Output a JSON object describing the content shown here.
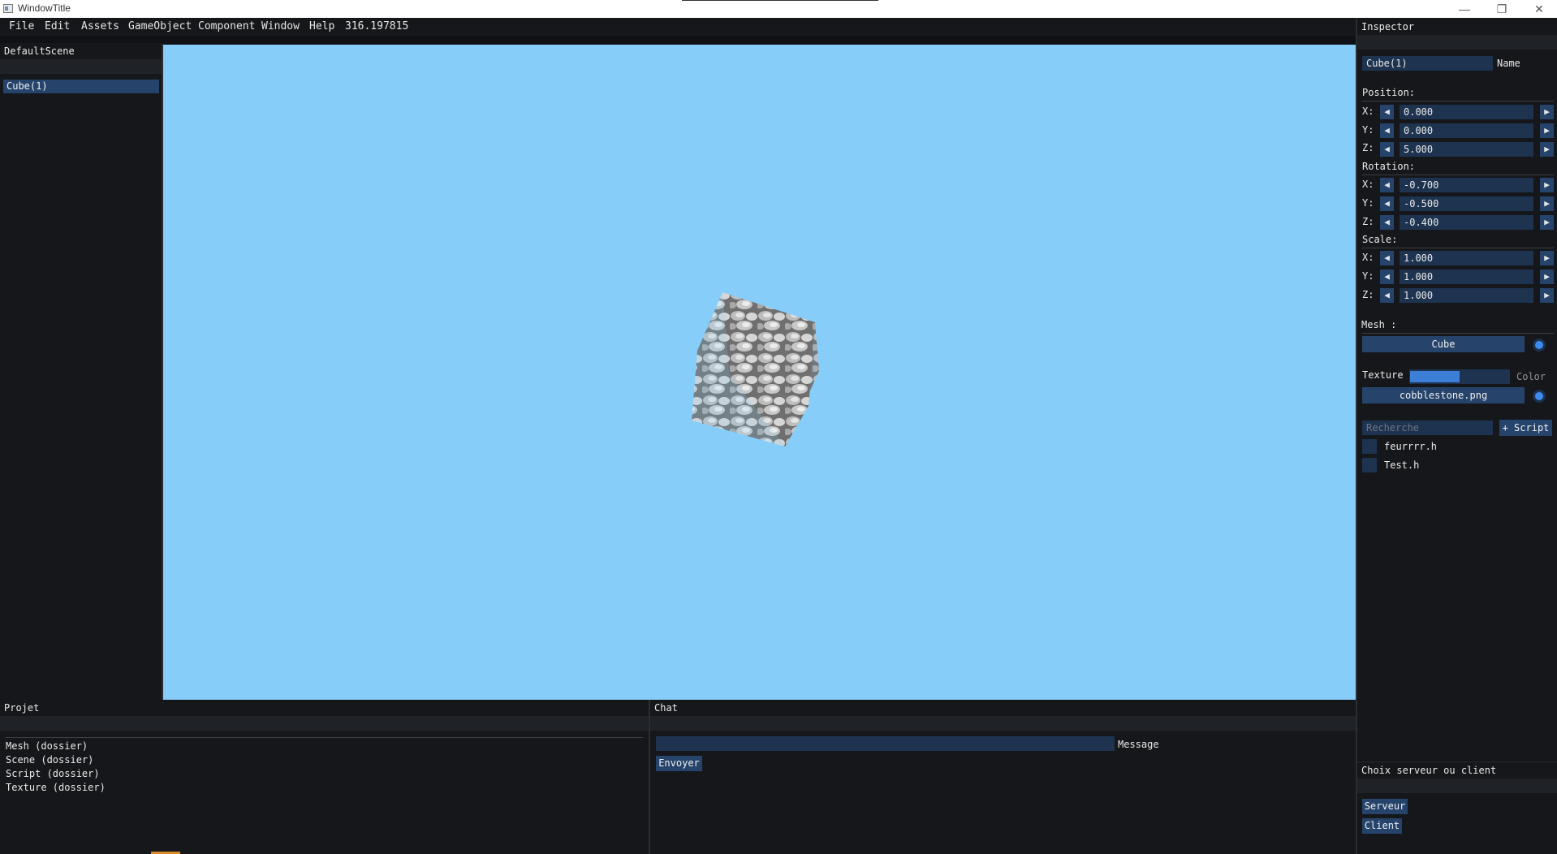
{
  "window": {
    "title": "WindowTitle",
    "minimize_glyph": "—",
    "maximize_glyph": "❐",
    "close_glyph": "✕"
  },
  "menu": {
    "items": [
      "File",
      "Edit",
      "Assets",
      "GameObject",
      "Component",
      "Window",
      "Help"
    ],
    "fps": "316.197815"
  },
  "scene": {
    "title": "DefaultScene",
    "items": [
      "Cube(1)"
    ]
  },
  "viewport": {
    "sky_color": "#87cdf9",
    "object_texture": "cobblestone"
  },
  "inspector": {
    "title": "Inspector",
    "name_value": "Cube(1)",
    "name_label": "Name",
    "position": {
      "label": "Position:",
      "rows": [
        {
          "axis": "X:",
          "value": "0.000"
        },
        {
          "axis": "Y:",
          "value": "0.000"
        },
        {
          "axis": "Z:",
          "value": "5.000"
        }
      ]
    },
    "rotation": {
      "label": "Rotation:",
      "rows": [
        {
          "axis": "X:",
          "value": "-0.700"
        },
        {
          "axis": "Y:",
          "value": "-0.500"
        },
        {
          "axis": "Z:",
          "value": "-0.400"
        }
      ]
    },
    "scale": {
      "label": "Scale:",
      "rows": [
        {
          "axis": "X:",
          "value": "1.000"
        },
        {
          "axis": "Y:",
          "value": "1.000"
        },
        {
          "axis": "Z:",
          "value": "1.000"
        }
      ]
    },
    "arrow_left": "◀",
    "arrow_right": "▶",
    "mesh_label": "Mesh :",
    "mesh_value": "Cube",
    "texture_label": "Texture",
    "color_label": "Color",
    "color_swatch": "#3d7fd6",
    "color_fill": 0.5,
    "texture_value": "cobblestone.png",
    "search_placeholder": "Recherche",
    "add_script_label": "+ Script",
    "scripts": [
      "feurrrr.h",
      "Test.h"
    ]
  },
  "network": {
    "title": "Choix serveur ou client",
    "server_label": "Serveur",
    "client_label": "Client"
  },
  "project": {
    "title": "Projet",
    "items": [
      "Mesh (dossier)",
      "Scene (dossier)",
      "Script (dossier)",
      "Texture (dossier)"
    ]
  },
  "chat": {
    "title": "Chat",
    "message_label": "Message",
    "message_value": "",
    "send_label": "Envoyer"
  }
}
